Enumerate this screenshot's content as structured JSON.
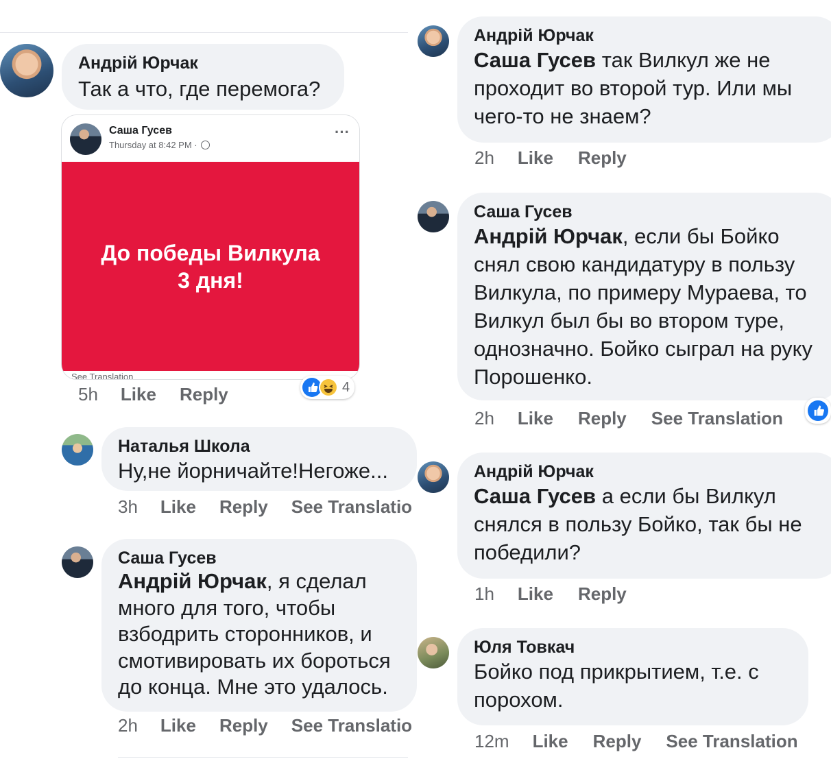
{
  "comments_left": [
    {
      "name": "Андрій Юрчак",
      "text": "Так а что, где перемога?",
      "time": "5h",
      "like": "Like",
      "reply": "Reply"
    },
    {
      "name": "Наталья Школа",
      "text": "Ну,не йорничайте!Негоже...",
      "time": "3h",
      "like": "Like",
      "reply": "Reply",
      "translate": "See Translatio"
    },
    {
      "name": "Саша Гусев",
      "mention": "Андрій Юрчак",
      "text": ", я сделал много для того, чтобы взбодрить сторонников, и смотивировать их бороться до конца. Мне это удалось.",
      "time": "2h",
      "like": "Like",
      "reply": "Reply",
      "translate": "See Translatio"
    }
  ],
  "shared_post": {
    "author": "Саша Гусев",
    "timestamp": "Thursday at 8:42 PM ·",
    "menu": "···",
    "headline_line1": "До победы Вилкула",
    "headline_line2": "3 дня!",
    "see_translation": "See Translation",
    "reaction_count": "4",
    "reaction_icons": [
      "like-icon",
      "haha-icon"
    ]
  },
  "comments_right": [
    {
      "name": "Андрій Юрчак",
      "mention": "Саша Гусев",
      "text": " так Вилкул же не проходит во второй тур. Или мы чего-то не знаем?",
      "time": "2h",
      "like": "Like",
      "reply": "Reply"
    },
    {
      "name": "Саша Гусев",
      "mention": "Андрій Юрчак",
      "text": ", если бы Бойко снял свою кандидатуру в пользу Вилкула, по примеру Мураева, то Вилкул был бы во втором туре, однозначно. Бойко сыграл на руку Порошенко.",
      "time": "2h",
      "like": "Like",
      "reply": "Reply",
      "translate": "See Translation",
      "reaction_icon": "like-icon"
    },
    {
      "name": "Андрій Юрчак",
      "mention": "Саша Гусев",
      "text": " а если бы Вилкул снялся в пользу Бойко, так бы не победили?",
      "time": "1h",
      "like": "Like",
      "reply": "Reply"
    },
    {
      "name": "Юля Товкач",
      "text": "Бойко под прикрытием, т.е. с порохом.",
      "time": "12m",
      "like": "Like",
      "reply": "Reply",
      "translate": "See Translation"
    }
  ],
  "colors": {
    "bubble": "#f0f2f5",
    "post_red": "#e4173e",
    "like_blue": "#1877f2",
    "meta_gray": "#65676b"
  }
}
